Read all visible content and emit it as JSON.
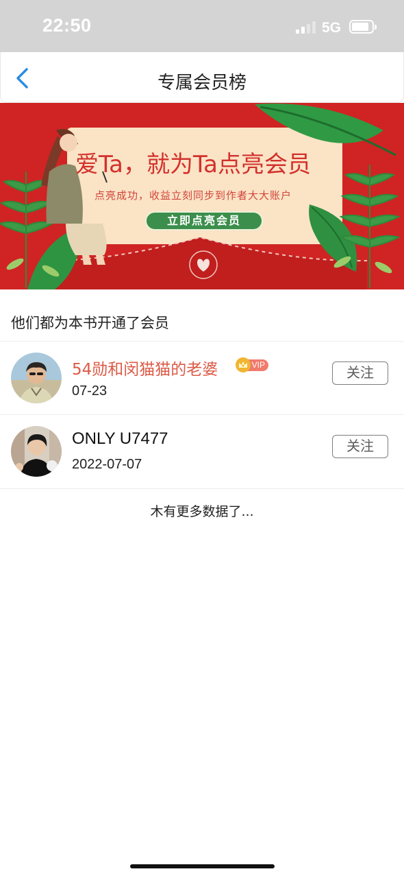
{
  "status_bar": {
    "time": "22:50",
    "network": "5G",
    "icons": [
      "signal-icon",
      "battery-icon"
    ]
  },
  "nav": {
    "back_icon": "chevron-left-icon",
    "title": "专属会员榜",
    "accent_color": "#2b8ce3"
  },
  "banner": {
    "headline": "爱Ta，就为Ta点亮会员",
    "subtitle": "点亮成功，收益立刻同步到作者大大账户",
    "cta_label": "立即点亮会员",
    "colors": {
      "background": "#cf2423",
      "card": "#fbe3c6",
      "cta": "#3b8e4b"
    }
  },
  "section": {
    "title": "他们都为本书开通了会员"
  },
  "members": [
    {
      "name": "54勋和闵猫猫的老婆",
      "date": "07-23",
      "vip": true,
      "vip_label": "VIP",
      "follow_label": "关注"
    },
    {
      "name": "ONLY U7477",
      "date": "2022-07-07",
      "vip": false,
      "follow_label": "关注"
    }
  ],
  "footer": {
    "no_more_text": "木有更多数据了..."
  }
}
